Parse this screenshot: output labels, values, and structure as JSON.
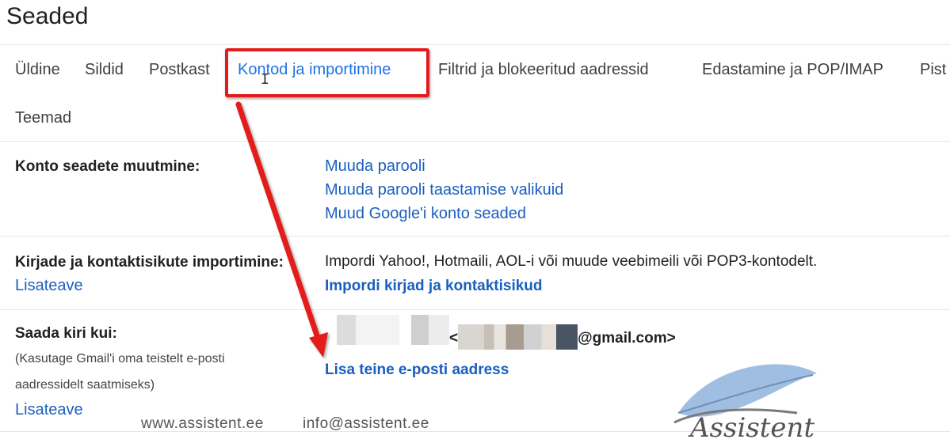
{
  "page": {
    "title": "Seaded"
  },
  "tabs": [
    {
      "label": "Üldine",
      "active": false
    },
    {
      "label": "Sildid",
      "active": false
    },
    {
      "label": "Postkast",
      "active": false
    },
    {
      "label": "Kontod ja importimine",
      "active": true
    },
    {
      "label": "Filtrid ja blokeeritud aadressid",
      "active": false
    },
    {
      "label": "Edastamine ja POP/IMAP",
      "active": false
    },
    {
      "label": "Pist",
      "active": false
    },
    {
      "label": "Teemad",
      "active": false
    }
  ],
  "sections": {
    "account": {
      "label": "Konto seadete muutmine:",
      "links": [
        "Muuda parooli",
        "Muuda parooli taastamise valikuid",
        "Muud Google'i konto seaded"
      ]
    },
    "import": {
      "label": "Kirjade ja kontaktisikute importimine:",
      "learn_more": "Lisateave",
      "description": "Impordi Yahoo!, Hotmaili, AOL-i või muude veebimeili või POP3-kontodelt.",
      "action": "Impordi kirjad ja kontaktisikud"
    },
    "send_as": {
      "label": "Saada kiri kui:",
      "hint_line1": "(Kasutage Gmail'i oma teistelt e-posti",
      "hint_line2": "aadressidelt saatmiseks)",
      "learn_more": "Lisateave",
      "email_prefix": "<",
      "email_suffix": "@gmail.com>",
      "action": "Lisa teine e-posti aadress"
    }
  },
  "footer": {
    "website": "www.assistent.ee",
    "email": "info@assistent.ee"
  },
  "logo": {
    "text": "Assistent"
  },
  "colors": {
    "link": "#1a5fbf",
    "active_tab": "#1a73e8",
    "annotation": "#e31b1b"
  }
}
